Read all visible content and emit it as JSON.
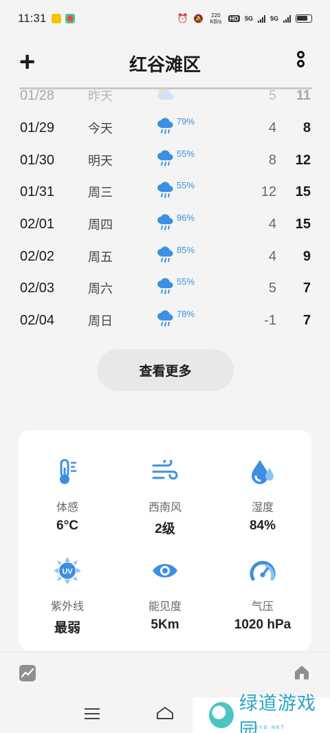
{
  "status_bar": {
    "time": "11:31",
    "net_speed": "220 KB/s",
    "sim": "HD",
    "net1": "5G",
    "net2": "5G"
  },
  "header": {
    "title": "红谷滩区",
    "add_icon": "plus-icon",
    "more_icon": "vertical-dots-icon"
  },
  "forecast": [
    {
      "date": "01/28",
      "day": "昨天",
      "icon": "partly-cloudy-icon",
      "pct": "",
      "low": "5",
      "high": "11"
    },
    {
      "date": "01/29",
      "day": "今天",
      "icon": "rain-cloud-icon",
      "pct": "79%",
      "low": "4",
      "high": "8"
    },
    {
      "date": "01/30",
      "day": "明天",
      "icon": "rain-cloud-icon",
      "pct": "55%",
      "low": "8",
      "high": "12"
    },
    {
      "date": "01/31",
      "day": "周三",
      "icon": "rain-cloud-icon",
      "pct": "55%",
      "low": "12",
      "high": "15"
    },
    {
      "date": "02/01",
      "day": "周四",
      "icon": "rain-cloud-icon",
      "pct": "96%",
      "low": "4",
      "high": "15"
    },
    {
      "date": "02/02",
      "day": "周五",
      "icon": "rain-cloud-icon",
      "pct": "85%",
      "low": "4",
      "high": "9"
    },
    {
      "date": "02/03",
      "day": "周六",
      "icon": "rain-cloud-icon",
      "pct": "55%",
      "low": "5",
      "high": "7"
    },
    {
      "date": "02/04",
      "day": "周日",
      "icon": "rain-cloud-icon",
      "pct": "78%",
      "low": "-1",
      "high": "7"
    }
  ],
  "more_button": "查看更多",
  "details": [
    {
      "label": "体感",
      "value": "6°C",
      "icon": "thermometer-icon"
    },
    {
      "label": "西南风",
      "value": "2级",
      "icon": "wind-icon"
    },
    {
      "label": "湿度",
      "value": "84%",
      "icon": "humidity-drop-icon"
    },
    {
      "label": "紫外线",
      "value": "最弱",
      "icon": "uv-sun-icon"
    },
    {
      "label": "能见度",
      "value": "5Km",
      "icon": "eye-icon"
    },
    {
      "label": "气压",
      "value": "1020 hPa",
      "icon": "gauge-icon"
    }
  ],
  "bottom_nav": {
    "left_icon": "trend-chart-icon",
    "right_icon": "home-icon"
  },
  "watermark": {
    "text": "绿道游戏园",
    "sub": "LDYG.NET"
  },
  "colors": {
    "accent": "#3d8fe0",
    "background": "#f4f4f4",
    "card": "#ffffff"
  }
}
